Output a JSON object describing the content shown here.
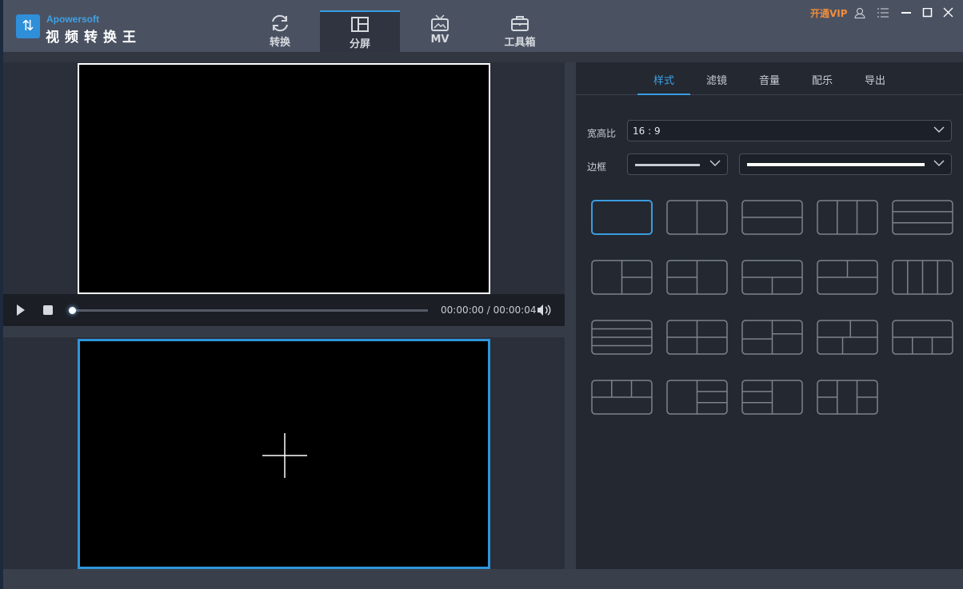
{
  "app": {
    "brand": "Apowersoft",
    "name": "视频转换王",
    "vip": "开通VIP"
  },
  "nav": [
    {
      "label": "转换",
      "icon": "refresh-icon"
    },
    {
      "label": "分屏",
      "icon": "split-screen-icon",
      "active": true
    },
    {
      "label": "MV",
      "icon": "tv-icon"
    },
    {
      "label": "工具箱",
      "icon": "toolbox-icon"
    }
  ],
  "player": {
    "time": "00:00:00 / 00:00:04",
    "progress": 0
  },
  "panel": {
    "tabs": [
      {
        "label": "样式",
        "active": true
      },
      {
        "label": "滤镜"
      },
      {
        "label": "音量"
      },
      {
        "label": "配乐"
      },
      {
        "label": "导出"
      }
    ],
    "aspect_label": "宽高比",
    "aspect_value": "16 : 9",
    "border_label": "边框",
    "layouts": [
      "layout-1",
      "layout-2",
      "layout-3",
      "layout-4",
      "layout-5",
      "layout-6",
      "layout-7",
      "layout-8",
      "layout-9",
      "layout-10",
      "layout-11",
      "layout-12",
      "layout-13",
      "layout-14",
      "layout-15",
      "layout-16",
      "layout-17",
      "layout-18",
      "layout-19"
    ],
    "selected_layout": "layout-1"
  },
  "colors": {
    "accent": "#3b9ce0",
    "vip": "#f08d3a",
    "titlebar": "#4a5262",
    "panel": "#232831"
  }
}
